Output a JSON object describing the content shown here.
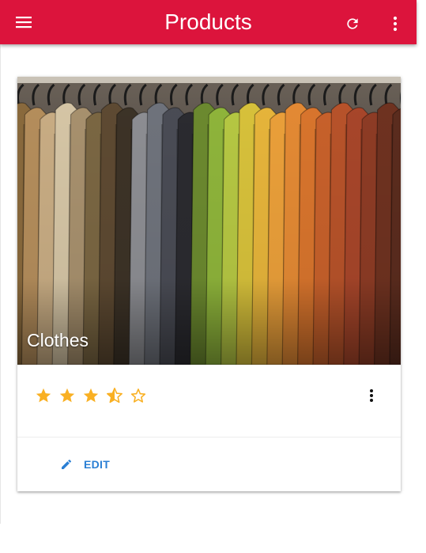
{
  "appbar": {
    "title": "Products",
    "background": "#dc143c",
    "icons": {
      "menu": "hamburger-menu-icon",
      "refresh": "refresh-icon",
      "more": "more-vertical-icon"
    }
  },
  "card": {
    "image_description_icon": "photo-clothes-rack",
    "title": "Clothes",
    "rating": {
      "value": 3.5,
      "max": 5,
      "star_color": "#f9b023"
    },
    "more_icon": "more-vertical-icon",
    "actions": {
      "edit_label": "EDIT",
      "edit_icon": "pencil-icon",
      "accent": "#2a7fd4"
    }
  }
}
